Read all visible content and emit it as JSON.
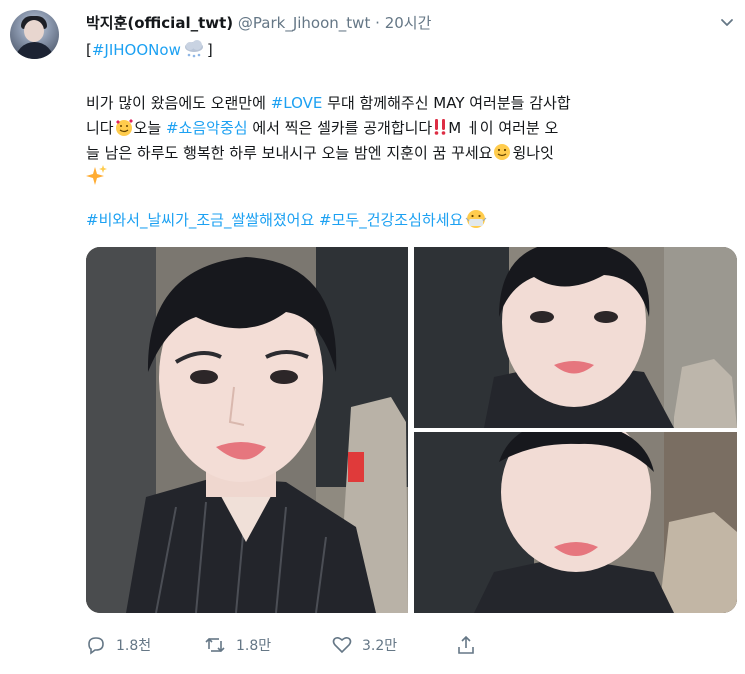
{
  "tweet": {
    "display_name": "박지훈(official_twt)",
    "handle": "@Park_Jihoon_twt",
    "separator": "·",
    "time": "20시간",
    "hashtag_top": "#JIHOONow",
    "lines": [
      {
        "a": "비가 많이 왔음에도 오랜만에 ",
        "tag": "#LOVE",
        "b": " 무대 함께해주신 MAY 여러분들 감사합"
      },
      {
        "a": "니다",
        "b": "오늘 ",
        "tag": "#쇼음악중심",
        "c": " 에서 찍은 셀카를 공개합니다",
        "d": "M ㅔ이 여러분 오"
      },
      {
        "a": "늘 남은 하루도 행복한 하루 보내시구 오늘 밤엔 지훈이 꿈 꾸세요",
        "b": "윙나잇"
      }
    ],
    "hashtag_line": "#비와서_날씨가_조금_쌀쌀해졌어요 #모두_건강조심하세요"
  },
  "icons": {
    "caret": "chevron-down-icon",
    "cloud": "cloud-snow-emoji",
    "smiling_hearts": "smiling-face-hearts-emoji",
    "exclamation": "double-exclamation-emoji",
    "slight_smile": "slightly-smiling-emoji",
    "sparkles": "sparkles-emoji",
    "mask": "medical-mask-emoji",
    "reply": "reply-icon",
    "retweet": "retweet-icon",
    "like": "heart-icon",
    "share": "share-icon"
  },
  "actions": {
    "reply_count": "1.8천",
    "retweet_count": "1.8만",
    "like_count": "3.2만"
  },
  "colors": {
    "link": "#1da1f2",
    "meta": "#657786",
    "text": "#14171a"
  }
}
